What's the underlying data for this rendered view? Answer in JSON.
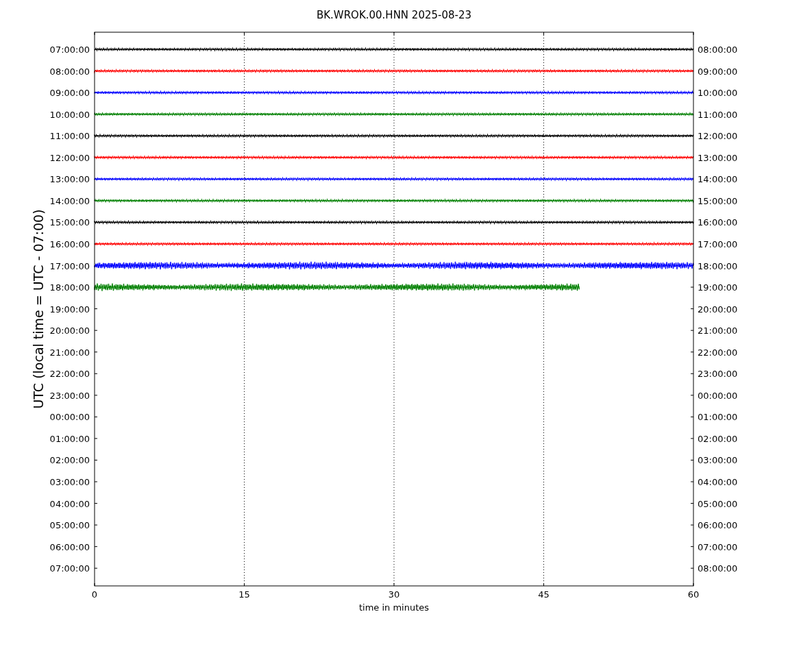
{
  "plot": {
    "title": "BK.WROK.00.HNN 2025-08-23",
    "ylabel": "UTC (local time = UTC - 07:00)",
    "xlabel": "time in minutes",
    "xticks": [
      "0",
      "15",
      "30",
      "45",
      "60"
    ],
    "left_ticks": [
      "07:00:00",
      "08:00:00",
      "09:00:00",
      "10:00:00",
      "11:00:00",
      "12:00:00",
      "13:00:00",
      "14:00:00",
      "15:00:00",
      "16:00:00",
      "17:00:00",
      "18:00:00",
      "19:00:00",
      "20:00:00",
      "21:00:00",
      "22:00:00",
      "23:00:00",
      "00:00:00",
      "01:00:00",
      "02:00:00",
      "03:00:00",
      "04:00:00",
      "05:00:00",
      "06:00:00",
      "07:00:00"
    ],
    "right_ticks": [
      "08:00:00",
      "09:00:00",
      "10:00:00",
      "11:00:00",
      "12:00:00",
      "13:00:00",
      "14:00:00",
      "15:00:00",
      "16:00:00",
      "17:00:00",
      "18:00:00",
      "19:00:00",
      "20:00:00",
      "21:00:00",
      "22:00:00",
      "23:00:00",
      "00:00:00",
      "01:00:00",
      "02:00:00",
      "03:00:00",
      "04:00:00",
      "05:00:00",
      "06:00:00",
      "07:00:00",
      "08:00:00"
    ],
    "traces": [
      {
        "color": "#000000",
        "kind": "quiet",
        "level": 1
      },
      {
        "color": "#ff0000",
        "kind": "quiet",
        "level": 1
      },
      {
        "color": "#0000ff",
        "kind": "quiet",
        "level": 1
      },
      {
        "color": "#008000",
        "kind": "quiet",
        "level": 1
      },
      {
        "color": "#000000",
        "kind": "quiet",
        "level": 1
      },
      {
        "color": "#ff0000",
        "kind": "quiet",
        "level": 1
      },
      {
        "color": "#0000ff",
        "kind": "quiet",
        "level": 1
      },
      {
        "color": "#008000",
        "kind": "quiet",
        "level": 1
      },
      {
        "color": "#000000",
        "kind": "quiet",
        "level": 1
      },
      {
        "color": "#ff0000",
        "kind": "quiet",
        "level": 1
      },
      {
        "color": "#0000ff",
        "kind": "noisy",
        "level": 1
      },
      {
        "color": "#008000",
        "kind": "noisy",
        "level": 0.81
      }
    ]
  }
}
